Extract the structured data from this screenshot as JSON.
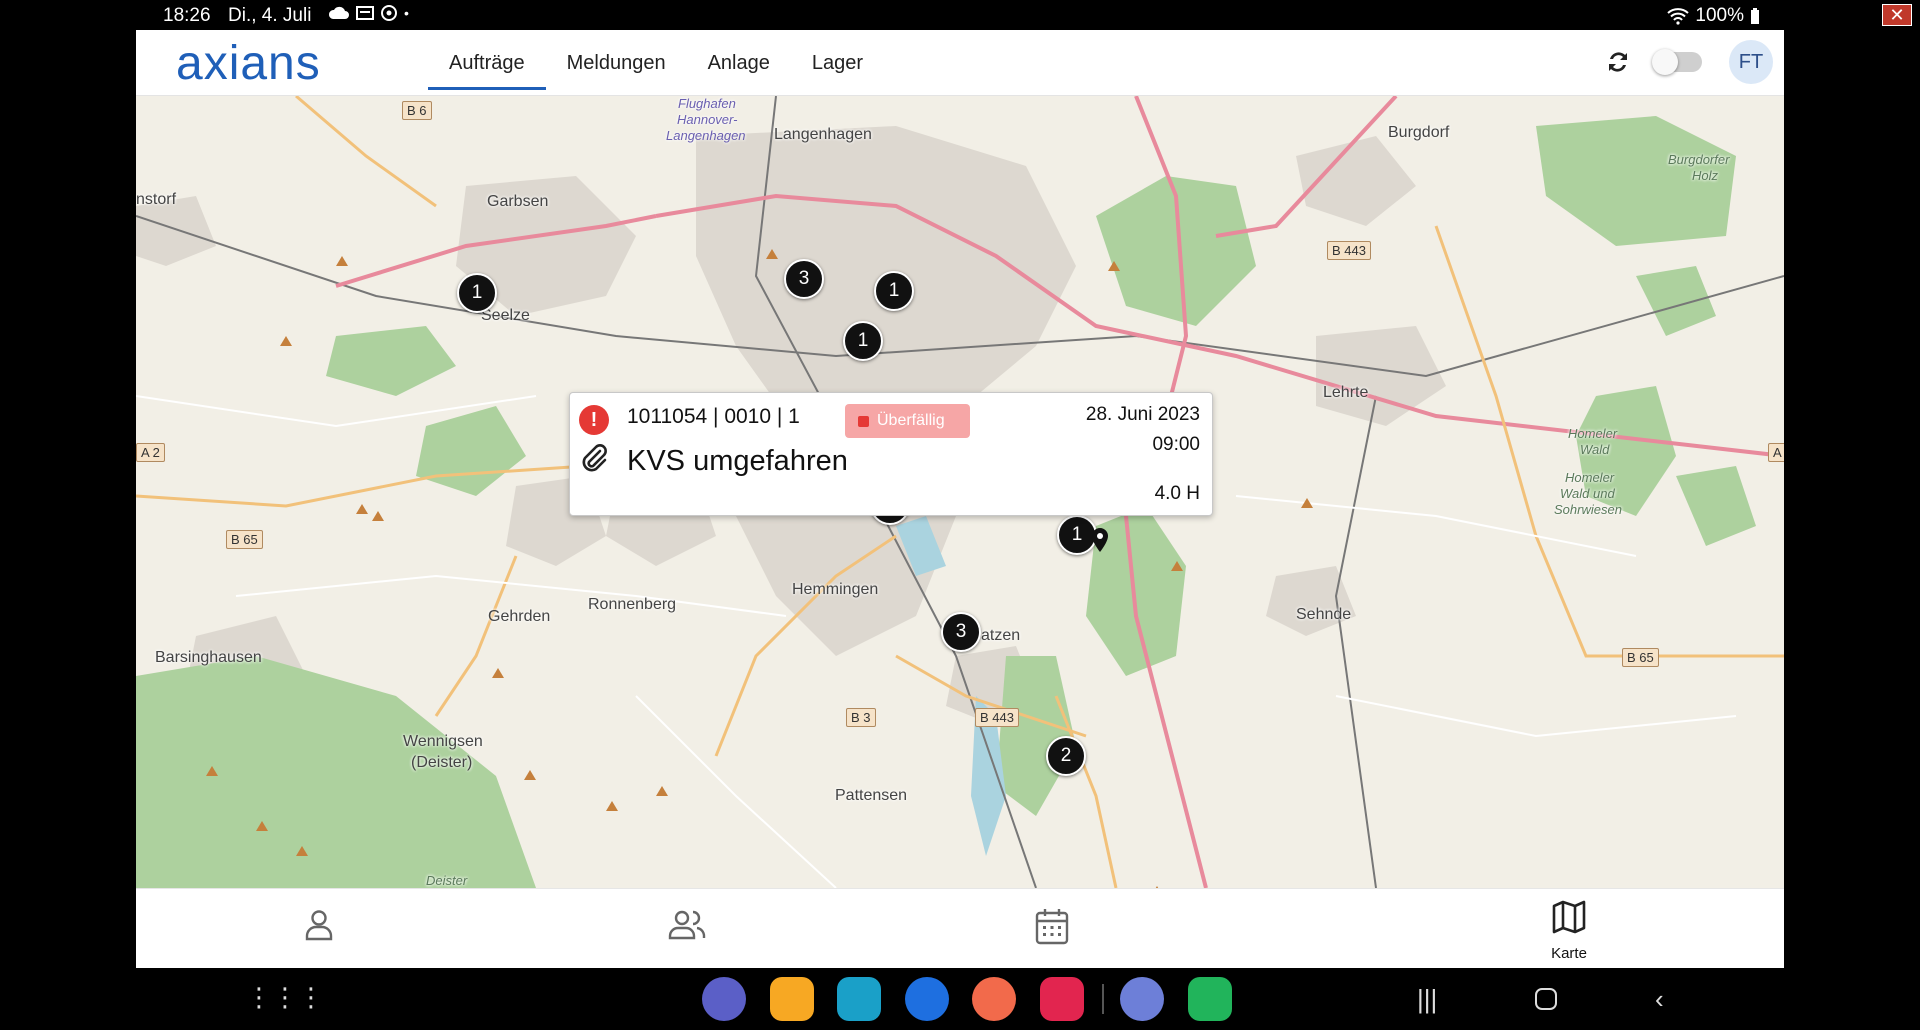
{
  "status_bar": {
    "time": "18:26",
    "date": "Di., 4. Juli",
    "battery": "100%"
  },
  "header": {
    "logo": "axians",
    "tabs": [
      {
        "label": "Aufträge",
        "active": true
      },
      {
        "label": "Meldungen",
        "active": false
      },
      {
        "label": "Anlage",
        "active": false
      },
      {
        "label": "Lager",
        "active": false
      }
    ],
    "avatar_initials": "FT"
  },
  "map": {
    "places": {
      "langenhagen": "Langenhagen",
      "burgdorf": "Burgdorf",
      "garbsen": "Garbsen",
      "seelze": "Seelze",
      "lehrte": "Lehrte",
      "sehnde": "Sehnde",
      "hemmingen": "Hemmingen",
      "ronnenberg": "Ronnenberg",
      "gehrden": "Gehrden",
      "barsinghausen": "Barsinghausen",
      "wennigsen": "Wennigsen",
      "deister_paren": "(Deister)",
      "pattensen": "Pattensen",
      "laatzen_partial": "atzen",
      "deister": "Deister",
      "nstorf_partial": "nstorf",
      "flughafen1": "Flughafen",
      "flughafen2": "Hannover-",
      "flughafen3": "Langenhagen",
      "burgdorfer1": "Burgdorfer",
      "burgdorfer2": "Holz",
      "homeler1": "Homeler",
      "homeler2": "Wald",
      "homeler3": "Homeler",
      "homeler4": "Wald und",
      "homeler5": "Sohrwiesen"
    },
    "roads": {
      "b6": "B 6",
      "b443a": "B 443",
      "b443b": "B 443",
      "b65a": "B 65",
      "b65b": "B 65",
      "b3": "B 3",
      "a2": "A 2",
      "a_right": "A"
    },
    "markers": [
      "1",
      "3",
      "1",
      "1",
      "1",
      "1",
      "3",
      "2"
    ]
  },
  "popup": {
    "alert_icon": "!",
    "ident": "1011054 | 0010 | 1",
    "status_badge": "Überfällig",
    "title": "KVS umgefahren",
    "date": "28. Juni 2023",
    "time": "09:00",
    "duration": "4.0 H",
    "colors": {
      "alert": "#e53935",
      "badge_bg": "#f6a6a6"
    }
  },
  "bottom_nav": {
    "items": [
      {
        "icon": "person-icon",
        "label": ""
      },
      {
        "icon": "group-icon",
        "label": ""
      },
      {
        "icon": "calendar-icon",
        "label": ""
      },
      {
        "icon": "map-icon",
        "label": "Karte"
      }
    ]
  },
  "colors": {
    "brand": "#1f5fb8"
  }
}
